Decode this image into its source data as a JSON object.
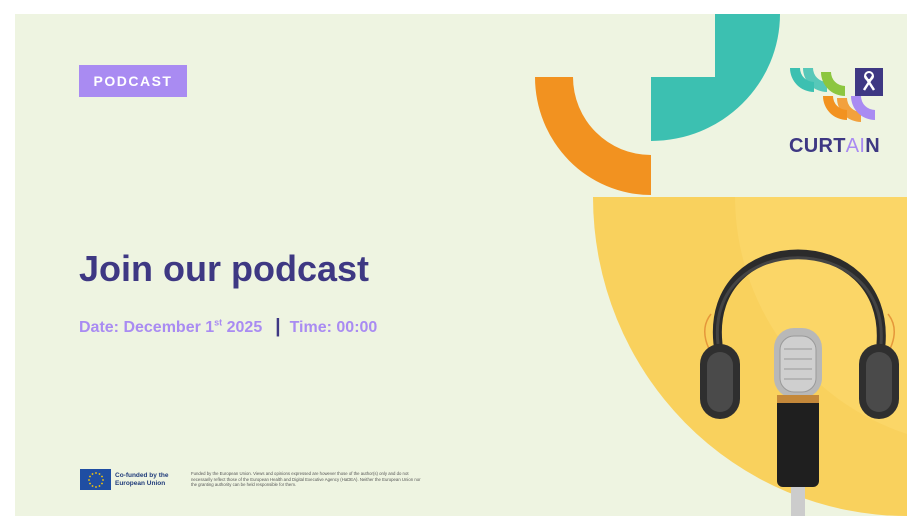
{
  "tag": "PODCAST",
  "title": "Join our podcast",
  "event": {
    "date_prefix": "Date: December 1",
    "date_sup": "st",
    "date_suffix": " 2025",
    "separator": "|",
    "time": "Time: 00:00"
  },
  "logo": {
    "part1": "CURT",
    "part2": "AI",
    "part3": "N"
  },
  "footer": {
    "cofunded": "Co-funded by the European Union",
    "disclaimer": "Funded by the European Union. Views and opinions expressed are however those of the author(s) only and do not necessarily reflect those of the European Health and Digital Executive Agency (HaDEA). Neither the European Union nor the granting authority can be held responsible for them."
  },
  "colors": {
    "background": "#eef4e1",
    "purple": "#a98bf2",
    "navy": "#3e3883",
    "orange": "#f29220",
    "teal": "#3cc0b1",
    "yellow": "#f9d15d",
    "green": "#8cc63f"
  }
}
